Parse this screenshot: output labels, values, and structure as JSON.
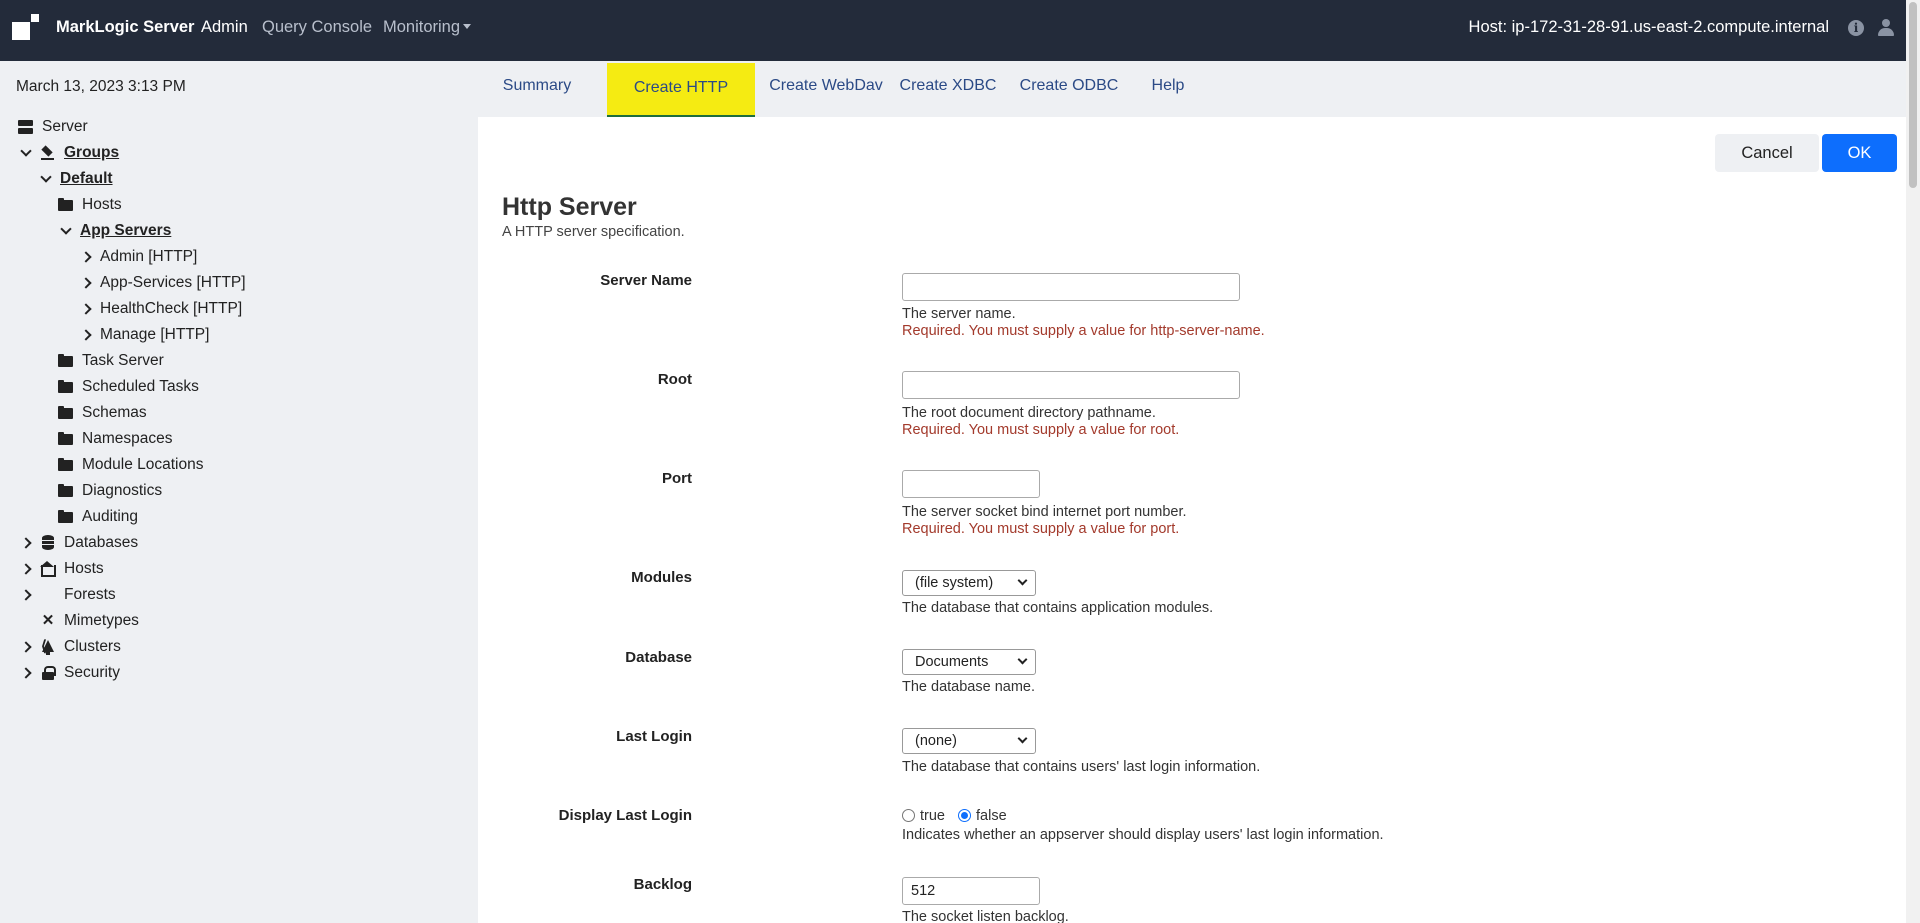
{
  "topbar": {
    "brand": "MarkLogic Server",
    "nav": [
      "Admin",
      "Query Console",
      "Monitoring"
    ],
    "host": "Host: ip-172-31-28-91.us-east-2.compute.internal"
  },
  "sidebar": {
    "date": "March 13, 2023 3:13 PM",
    "tree": [
      {
        "label": "Server",
        "icon": "server-icon"
      },
      {
        "label": "Groups",
        "icon": "layers-icon"
      },
      {
        "label": "Default",
        "icon": ""
      },
      {
        "label": "Hosts",
        "icon": "folder-icon"
      },
      {
        "label": "App Servers",
        "icon": ""
      },
      {
        "label": "Admin [HTTP]",
        "icon": ""
      },
      {
        "label": "App-Services [HTTP]",
        "icon": ""
      },
      {
        "label": "HealthCheck [HTTP]",
        "icon": ""
      },
      {
        "label": "Manage [HTTP]",
        "icon": ""
      },
      {
        "label": "Task Server",
        "icon": "folder-icon"
      },
      {
        "label": "Scheduled Tasks",
        "icon": "folder-icon"
      },
      {
        "label": "Schemas",
        "icon": "folder-icon"
      },
      {
        "label": "Namespaces",
        "icon": "folder-icon"
      },
      {
        "label": "Module Locations",
        "icon": "folder-icon"
      },
      {
        "label": "Diagnostics",
        "icon": "folder-icon"
      },
      {
        "label": "Auditing",
        "icon": "folder-icon"
      },
      {
        "label": "Databases",
        "icon": "database-icon"
      },
      {
        "label": "Hosts",
        "icon": "hosts-icon"
      },
      {
        "label": "Forests",
        "icon": "tree-icon"
      },
      {
        "label": "Mimetypes",
        "icon": "mimetypes-icon"
      },
      {
        "label": "Clusters",
        "icon": "share-icon"
      },
      {
        "label": "Security",
        "icon": "lock-icon"
      }
    ]
  },
  "tabs": [
    "Summary",
    "Create HTTP",
    "Create WebDav",
    "Create XDBC",
    "Create ODBC",
    "Help"
  ],
  "actions": {
    "cancel": "Cancel",
    "ok": "OK"
  },
  "form": {
    "title": "Http Server",
    "subtitle": "A HTTP server specification.",
    "server_name": {
      "label": "Server Name",
      "value": "",
      "desc": "The server name.",
      "error": "Required. You must supply a value for http-server-name."
    },
    "root": {
      "label": "Root",
      "value": "",
      "desc": "The root document directory pathname.",
      "error": "Required. You must supply a value for root."
    },
    "port": {
      "label": "Port",
      "value": "",
      "desc": "The server socket bind internet port number.",
      "error": "Required. You must supply a value for port."
    },
    "modules": {
      "label": "Modules",
      "value": "(file system)",
      "desc": "The database that contains application modules."
    },
    "database": {
      "label": "Database",
      "value": "Documents",
      "desc": "The database name."
    },
    "last_login": {
      "label": "Last Login",
      "value": "(none)",
      "desc": "The database that contains users' last login information."
    },
    "display_last_login": {
      "label": "Display Last Login",
      "true_label": "true",
      "false_label": "false",
      "selected": "false",
      "desc": "Indicates whether an appserver should display users' last login information."
    },
    "backlog": {
      "label": "Backlog",
      "value": "512",
      "desc": "The socket listen backlog."
    }
  },
  "colors": {
    "topbar": "#232b3a",
    "active_tab": "#f5eb12",
    "ok_button": "#0d6efd",
    "error": "#a33a2c",
    "link": "#2b4a86"
  }
}
